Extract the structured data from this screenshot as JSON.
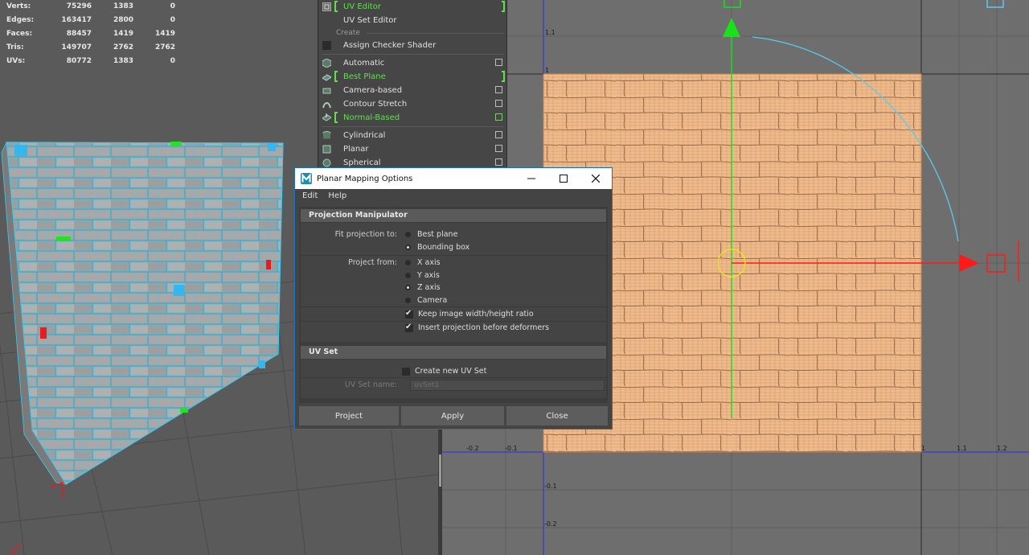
{
  "hud": {
    "rows": [
      {
        "label": "Verts:",
        "v1": "75296",
        "v2": "1383",
        "v3": "0"
      },
      {
        "label": "Edges:",
        "v1": "163417",
        "v2": "2800",
        "v3": "0"
      },
      {
        "label": "Faces:",
        "v1": "88457",
        "v2": "1419",
        "v3": "1419"
      },
      {
        "label": "Tris:",
        "v1": "149707",
        "v2": "2762",
        "v3": "2762"
      },
      {
        "label": "UVs:",
        "v1": "80772",
        "v2": "1383",
        "v3": "0"
      }
    ]
  },
  "menu": {
    "uv_editor": "UV Editor",
    "uv_set_editor": "UV Set Editor",
    "create_section": "Create",
    "assign_checker": "Assign Checker Shader",
    "automatic": "Automatic",
    "best_plane": "Best Plane",
    "camera_based": "Camera-based",
    "contour_stretch": "Contour Stretch",
    "normal_based": "Normal-Based",
    "cylindrical": "Cylindrical",
    "planar": "Planar",
    "spherical": "Spherical"
  },
  "dialog": {
    "title": "Planar Mapping Options",
    "menu_edit": "Edit",
    "menu_help": "Help",
    "section_projection": "Projection Manipulator",
    "fit_label": "Fit projection to:",
    "fit_best_plane": "Best plane",
    "fit_bounding_box": "Bounding box",
    "project_from_label": "Project from:",
    "x_axis": "X axis",
    "y_axis": "Y axis",
    "z_axis": "Z axis",
    "camera": "Camera",
    "keep_ratio": "Keep image width/height ratio",
    "insert_projection": "Insert projection before deformers",
    "section_uvset": "UV Set",
    "create_new_uvset": "Create new UV Set",
    "uvset_name_label": "UV Set name:",
    "uvset_name_value": "uvSet1",
    "btn_project": "Project",
    "btn_apply": "Apply",
    "btn_close": "Close"
  },
  "uv_ticks": {
    "x": [
      "-0.2",
      "-0.1",
      "1",
      "1.1",
      "1.2"
    ],
    "y": [
      "1.1",
      "1",
      "-0.1",
      "-0.2"
    ]
  },
  "colors": {
    "uv_fill": "#eebb8e",
    "uv_wire": "#d9955e",
    "mesh_wire": "#3fc8ee",
    "menu_selected": "#5fe04b",
    "axis_red": "#ff1a1a",
    "axis_green": "#17e317"
  }
}
